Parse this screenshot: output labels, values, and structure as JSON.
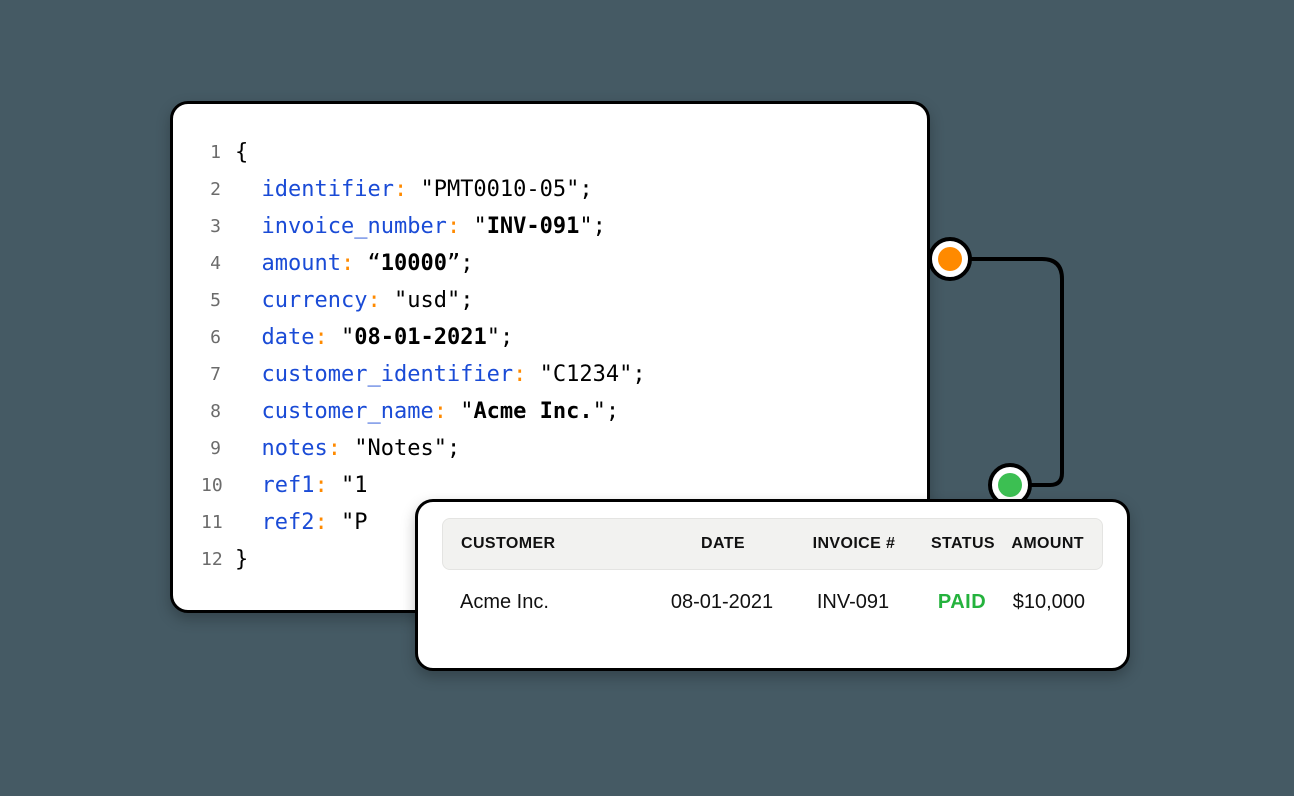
{
  "code": {
    "lines": [
      {
        "n": "1",
        "tokens": [
          {
            "t": "{",
            "cls": "tok-brace"
          }
        ]
      },
      {
        "n": "2",
        "tokens": [
          {
            "t": "  "
          },
          {
            "t": "identifier",
            "cls": "tok-key"
          },
          {
            "t": ":",
            "cls": "tok-colon"
          },
          {
            "t": " "
          },
          {
            "t": "\"PMT0010-05\"",
            "cls": "tok-str"
          },
          {
            "t": ";",
            "cls": "tok-punc"
          }
        ]
      },
      {
        "n": "3",
        "tokens": [
          {
            "t": "  "
          },
          {
            "t": "invoice_number",
            "cls": "tok-key"
          },
          {
            "t": ":",
            "cls": "tok-colon"
          },
          {
            "t": " "
          },
          {
            "t": "\"",
            "cls": "tok-str"
          },
          {
            "t": "INV-091",
            "cls": "tok-str tok-bold"
          },
          {
            "t": "\"",
            "cls": "tok-str"
          },
          {
            "t": ";",
            "cls": "tok-punc"
          }
        ]
      },
      {
        "n": "4",
        "tokens": [
          {
            "t": "  "
          },
          {
            "t": "amount",
            "cls": "tok-key"
          },
          {
            "t": ":",
            "cls": "tok-colon"
          },
          {
            "t": " "
          },
          {
            "t": "“",
            "cls": "tok-str"
          },
          {
            "t": "10000",
            "cls": "tok-str tok-bold"
          },
          {
            "t": "”",
            "cls": "tok-str"
          },
          {
            "t": ";",
            "cls": "tok-punc"
          }
        ]
      },
      {
        "n": "5",
        "tokens": [
          {
            "t": "  "
          },
          {
            "t": "currency",
            "cls": "tok-key"
          },
          {
            "t": ":",
            "cls": "tok-colon"
          },
          {
            "t": " "
          },
          {
            "t": "\"usd\"",
            "cls": "tok-str"
          },
          {
            "t": ";",
            "cls": "tok-punc"
          }
        ]
      },
      {
        "n": "6",
        "tokens": [
          {
            "t": "  "
          },
          {
            "t": "date",
            "cls": "tok-key"
          },
          {
            "t": ":",
            "cls": "tok-colon"
          },
          {
            "t": " "
          },
          {
            "t": "\"",
            "cls": "tok-str"
          },
          {
            "t": "08-01-2021",
            "cls": "tok-str tok-bold"
          },
          {
            "t": "\"",
            "cls": "tok-str"
          },
          {
            "t": ";",
            "cls": "tok-punc"
          }
        ]
      },
      {
        "n": "7",
        "tokens": [
          {
            "t": "  "
          },
          {
            "t": "customer_identifier",
            "cls": "tok-key"
          },
          {
            "t": ":",
            "cls": "tok-colon"
          },
          {
            "t": " "
          },
          {
            "t": "\"C1234\"",
            "cls": "tok-str"
          },
          {
            "t": ";",
            "cls": "tok-punc"
          }
        ]
      },
      {
        "n": "8",
        "tokens": [
          {
            "t": "  "
          },
          {
            "t": "customer_name",
            "cls": "tok-key"
          },
          {
            "t": ":",
            "cls": "tok-colon"
          },
          {
            "t": " "
          },
          {
            "t": "\"",
            "cls": "tok-str"
          },
          {
            "t": "Acme Inc.",
            "cls": "tok-str tok-bold"
          },
          {
            "t": "\"",
            "cls": "tok-str"
          },
          {
            "t": ";",
            "cls": "tok-punc"
          }
        ]
      },
      {
        "n": "9",
        "tokens": [
          {
            "t": "  "
          },
          {
            "t": "notes",
            "cls": "tok-key"
          },
          {
            "t": ":",
            "cls": "tok-colon"
          },
          {
            "t": " "
          },
          {
            "t": "\"Notes\"",
            "cls": "tok-str"
          },
          {
            "t": ";",
            "cls": "tok-punc"
          }
        ]
      },
      {
        "n": "10",
        "tokens": [
          {
            "t": "  "
          },
          {
            "t": "ref1",
            "cls": "tok-key"
          },
          {
            "t": ":",
            "cls": "tok-colon"
          },
          {
            "t": " "
          },
          {
            "t": "\"1",
            "cls": "tok-str"
          }
        ]
      },
      {
        "n": "11",
        "tokens": [
          {
            "t": "  "
          },
          {
            "t": "ref2",
            "cls": "tok-key"
          },
          {
            "t": ":",
            "cls": "tok-colon"
          },
          {
            "t": " "
          },
          {
            "t": "\"P",
            "cls": "tok-str"
          }
        ]
      },
      {
        "n": "12",
        "tokens": [
          {
            "t": "}",
            "cls": "tok-brace"
          }
        ]
      }
    ]
  },
  "invoice_table": {
    "headers": {
      "customer": "CUSTOMER",
      "date": "DATE",
      "invoice": "INVOICE #",
      "status": "STATUS",
      "amount": "AMOUNT"
    },
    "row": {
      "customer": "Acme Inc.",
      "date": "08-01-2021",
      "invoice": "INV-091",
      "status": "PAID",
      "amount": "$10,000"
    }
  },
  "colors": {
    "orange_node": "#ff8a00",
    "green_node": "#3cbf52",
    "status_paid": "#24b23d",
    "key": "#1a4bd6",
    "colon": "#ff8a00",
    "background": "#455a64"
  }
}
